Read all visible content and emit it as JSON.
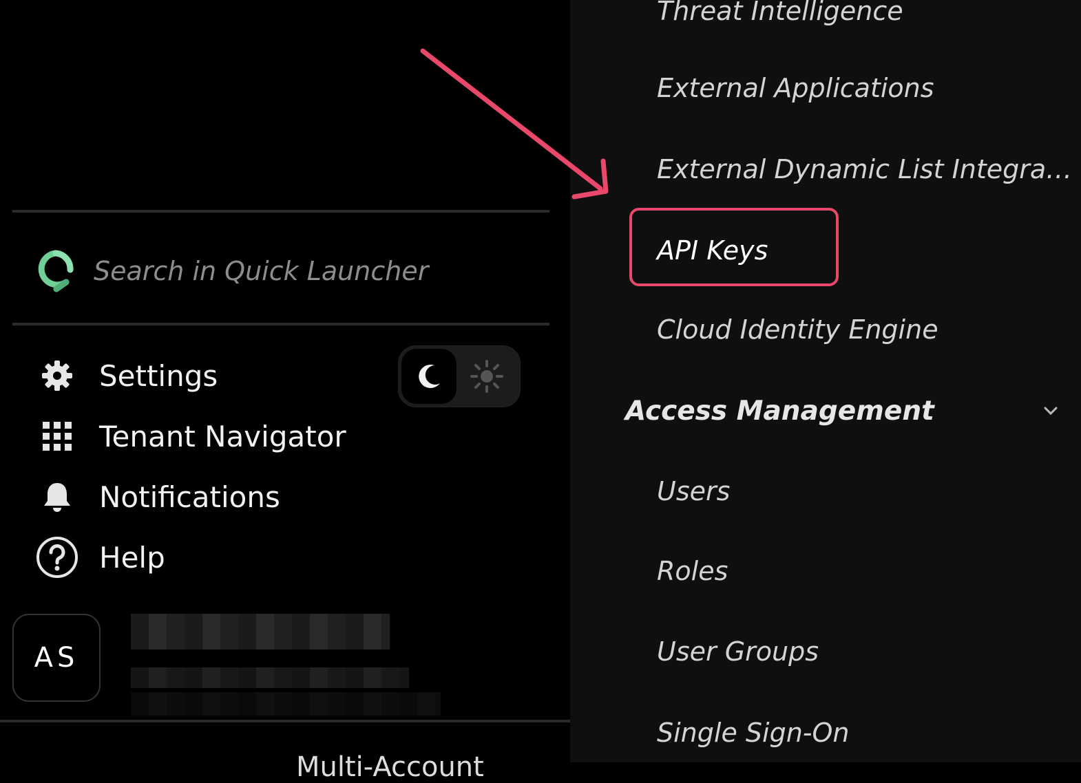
{
  "search": {
    "placeholder": "Search in Quick Launcher",
    "icon": "quick-launcher-logo-icon"
  },
  "menu": [
    {
      "label": "Settings",
      "icon": "gear-icon"
    },
    {
      "label": "Tenant Navigator",
      "icon": "grid-icon"
    },
    {
      "label": "Notifications",
      "icon": "bell-icon"
    },
    {
      "label": "Help",
      "icon": "help-circle-icon"
    }
  ],
  "theme": {
    "selected": "dark",
    "options": [
      "moon-icon",
      "sun-icon"
    ]
  },
  "user": {
    "initials": "AS"
  },
  "left_bottom_cut_text": "Multi-Account",
  "submenu": {
    "items_top": [
      "Threat Intelligence",
      "External Applications",
      "External Dynamic List Integra…",
      "API Keys",
      "Cloud Identity Engine"
    ],
    "selected": "API Keys",
    "section": {
      "label": "Access Management",
      "icon": "chevron-down-icon"
    },
    "items_bottom": [
      "Users",
      "Roles",
      "User Groups",
      "Single Sign-On"
    ]
  },
  "colors": {
    "highlight": "#e8496b",
    "logo_green": "#6fcf97",
    "panel_bg": "#0f0f0f"
  }
}
